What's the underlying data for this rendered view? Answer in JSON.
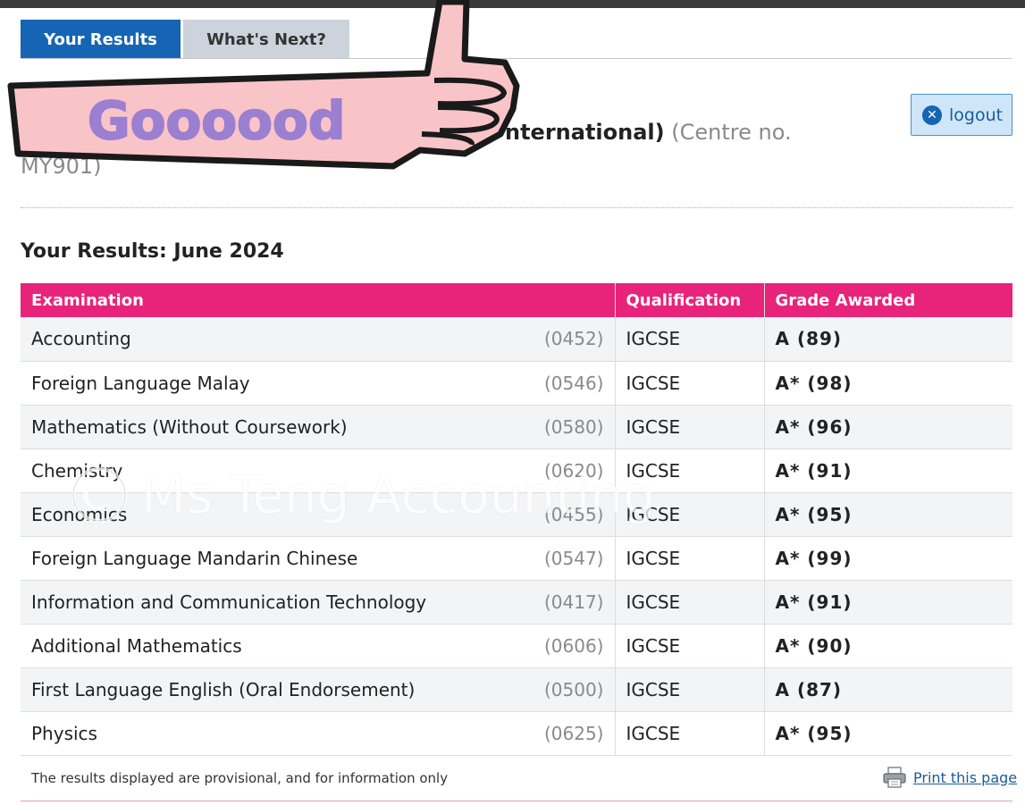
{
  "tabs": [
    {
      "label": "Your Results",
      "active": true
    },
    {
      "label": "What's Next?",
      "active": false
    }
  ],
  "centre": {
    "name_fragment": "nternational)",
    "centre_no_label": "(Centre no.",
    "centre_no_fragment": "MY901)"
  },
  "logout": {
    "label": "logout",
    "icon": "close-circle-icon"
  },
  "results": {
    "heading": "Your Results: June 2024",
    "columns": {
      "exam": "Examination",
      "qual": "Qualification",
      "grade": "Grade Awarded"
    },
    "rows": [
      {
        "subject": "Accounting",
        "code": "(0452)",
        "qual": "IGCSE",
        "grade": "A (89)"
      },
      {
        "subject": "Foreign Language Malay",
        "code": "(0546)",
        "qual": "IGCSE",
        "grade": "A* (98)"
      },
      {
        "subject": "Mathematics (Without Coursework)",
        "code": "(0580)",
        "qual": "IGCSE",
        "grade": "A* (96)"
      },
      {
        "subject": "Chemistry",
        "code": "(0620)",
        "qual": "IGCSE",
        "grade": "A* (91)"
      },
      {
        "subject": "Economics",
        "code": "(0455)",
        "qual": "IGCSE",
        "grade": "A* (95)"
      },
      {
        "subject": "Foreign Language Mandarin Chinese",
        "code": "(0547)",
        "qual": "IGCSE",
        "grade": "A* (99)"
      },
      {
        "subject": "Information and Communication Technology",
        "code": "(0417)",
        "qual": "IGCSE",
        "grade": "A* (91)"
      },
      {
        "subject": "Additional Mathematics",
        "code": "(0606)",
        "qual": "IGCSE",
        "grade": "A* (90)"
      },
      {
        "subject": "First Language English (Oral Endorsement)",
        "code": "(0500)",
        "qual": "IGCSE",
        "grade": "A (87)"
      },
      {
        "subject": "Physics",
        "code": "(0625)",
        "qual": "IGCSE",
        "grade": "A* (95)"
      }
    ]
  },
  "footer": {
    "note": "The results displayed are provisional, and for information only",
    "print_label": "Print this page",
    "print_icon": "printer-icon"
  },
  "sticker": {
    "text": "Goooood"
  },
  "watermark": {
    "text": "Ms Teng Accounting"
  },
  "colors": {
    "tab_active": "#1565b4",
    "table_header": "#e8237a",
    "logout_bg": "#cfe6f8",
    "sticker_pink": "#f9c4c8",
    "sticker_text": "#9b7fd0"
  }
}
